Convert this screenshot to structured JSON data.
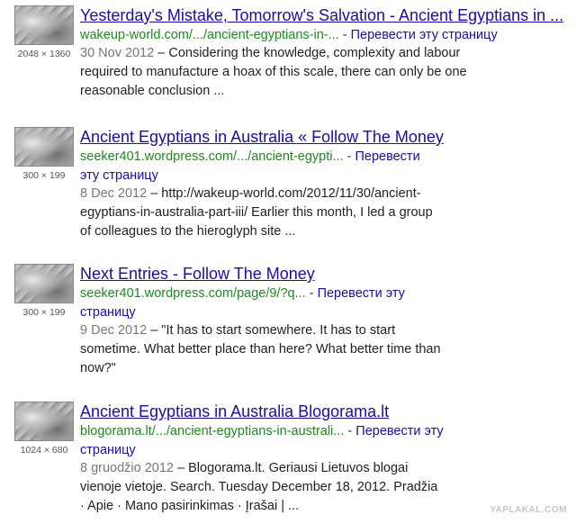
{
  "results": [
    {
      "title": "Yesterday's Mistake, Tomorrow's Salvation - Ancient Egyptians in ...",
      "url": "wakeup-world.com/.../ancient-egyptians-in-...",
      "sep": " - ",
      "translate": "Перевести эту страницу",
      "date": "30 Nov 2012",
      "snippet_lines": [
        " – Considering the knowledge, complexity and labour",
        "required to manufacture a hoax of this scale, there can only be one",
        "reasonable conclusion ..."
      ],
      "image_size": "2048 × 1360"
    },
    {
      "title": "Ancient Egyptians in Australia « Follow The Money",
      "url": "seeker401.wordpress.com/.../ancient-egypti...",
      "sep": " - ",
      "translate_line1": "Перевести",
      "translate_line2": "эту страницу",
      "date": "8 Dec 2012",
      "snippet_lines": [
        " – http://wakeup-world.com/2012/11/30/ancient-",
        "egyptians-in-australia-part-iii/ Earlier this month, I led a group",
        "of colleagues to the hieroglyph site ..."
      ],
      "image_size": "300 × 199"
    },
    {
      "title": "Next Entries - Follow The Money",
      "url": "seeker401.wordpress.com/page/9/?q...",
      "sep": " - ",
      "translate_line1": "Перевести эту",
      "translate_line2": "страницу",
      "date": "9 Dec 2012",
      "snippet_lines": [
        " – \"It has to start somewhere. It has to start",
        "sometime. What better place than here? What better time than",
        "now?\""
      ],
      "image_size": "300 × 199"
    },
    {
      "title": "Ancient Egyptians in Australia Blogorama.lt",
      "url": "blogorama.lt/.../ancient-egyptians-in-australi...",
      "sep": " - ",
      "translate_line1": "Перевести эту",
      "translate_line2": "страницу",
      "date": "8 gruodžio 2012",
      "snippet_lines": [
        " – Blogorama.lt. Geriausi Lietuvos blogai",
        "vienoje vietoje. Search. Tuesday December 18, 2012. Pradžia",
        "· Apie · Mano pasirinkimas · Įrašai | ..."
      ],
      "image_size": "1024 × 680"
    }
  ],
  "watermark": "YAPLAKAL.COM"
}
